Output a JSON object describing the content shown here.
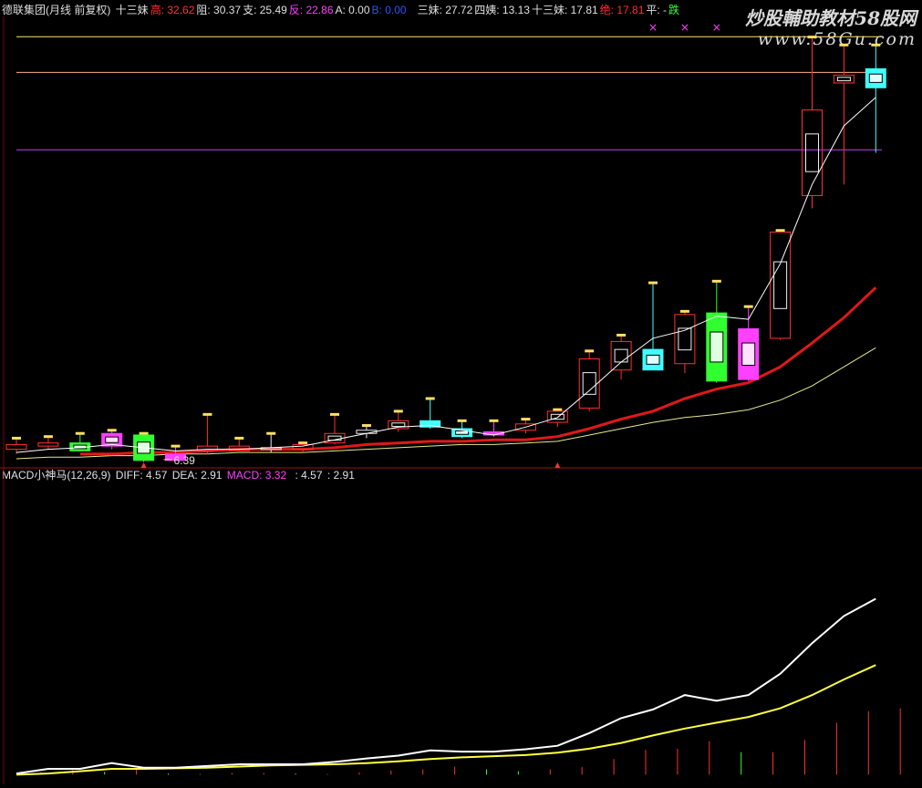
{
  "header": {
    "title": "德联集团(月线 前复权)",
    "items": [
      {
        "label": "十三妹",
        "color": "#e0e0e0"
      },
      {
        "label": "高: 32.62",
        "color": "#ff3030"
      },
      {
        "label": "阻: 30.37",
        "color": "#e0e0e0"
      },
      {
        "label": "支: 25.49",
        "color": "#e0e0e0"
      },
      {
        "label": "反: 22.86",
        "color": "#ff40ff"
      },
      {
        "label": "A: 0.00",
        "color": "#e0e0e0"
      },
      {
        "label": "B: 0.00",
        "color": "#3050ff"
      },
      {
        "label": "三妹: 27.72",
        "color": "#e0e0e0"
      },
      {
        "label": "四姨: 13.13",
        "color": "#e0e0e0"
      },
      {
        "label": "十三妹: 17.81",
        "color": "#e0e0e0"
      },
      {
        "label": "绝: 17.81",
        "color": "#ff3030"
      },
      {
        "label": "平: -",
        "color": "#e0e0e0"
      },
      {
        "label": "跌",
        "color": "#30ff30"
      }
    ]
  },
  "watermark": {
    "line1": "炒股輔助教材58股网",
    "line2": "www.58Gu.com"
  },
  "macd_header": {
    "name": "MACD小神马(12,26,9)",
    "diff": "DIFF: 4.57",
    "dea": "DEA: 2.91",
    "macd": "MACD: 3.32",
    "extra1": ": 4.57",
    "extra2": ": 2.91"
  },
  "colors": {
    "up": "#ff3030",
    "down_green": "#30ff30",
    "magenta": "#ff40ff",
    "cyan": "#40ffff",
    "ma_red": "#e01818",
    "ma_yellow": "#e8e890",
    "line_white": "#ffffff",
    "level_yellow": "#ffe080",
    "level_peach": "#ffb080",
    "level_magenta": "#c040ff",
    "cross_marker": "#ff40ff",
    "divider": "#a01010",
    "arrow": "#ff3030",
    "macd_diff": "#ffffff",
    "macd_dea": "#ffff40",
    "bar_yellow": "#ffe060"
  },
  "chart_data": [
    {
      "type": "candlestick",
      "title": "德联集团(月线 前复权)",
      "ylim": [
        5.6,
        33.9
      ],
      "levels": [
        {
          "name": "高",
          "value": 32.62
        },
        {
          "name": "阻",
          "value": 30.37
        },
        {
          "name": "支",
          "value": 25.49
        },
        {
          "name": "反",
          "value": 22.86
        }
      ],
      "candles": [
        {
          "o": 6.9,
          "h": 7.3,
          "l": 6.3,
          "c": 6.6,
          "color": "up"
        },
        {
          "o": 6.8,
          "h": 7.4,
          "l": 6.6,
          "c": 7.0,
          "color": "up"
        },
        {
          "o": 7.0,
          "h": 7.6,
          "l": 6.6,
          "c": 6.5,
          "color": "green"
        },
        {
          "o": 6.8,
          "h": 7.8,
          "l": 6.6,
          "c": 7.6,
          "color": "magenta"
        },
        {
          "o": 7.5,
          "h": 7.6,
          "l": 5.8,
          "c": 5.9,
          "color": "green"
        },
        {
          "o": 6.3,
          "h": 6.8,
          "l": 6.0,
          "c": 5.9,
          "color": "magenta"
        },
        {
          "o": 6.5,
          "h": 8.8,
          "l": 6.3,
          "c": 6.8,
          "color": "up"
        },
        {
          "o": 6.8,
          "h": 7.3,
          "l": 6.6,
          "c": 6.5,
          "color": "up"
        },
        {
          "o": 6.6,
          "h": 7.6,
          "l": 6.4,
          "c": 6.7,
          "color": "white"
        },
        {
          "o": 6.6,
          "h": 7.0,
          "l": 6.4,
          "c": 6.9,
          "color": "up"
        },
        {
          "o": 7.0,
          "h": 8.8,
          "l": 6.9,
          "c": 7.6,
          "color": "up"
        },
        {
          "o": 7.6,
          "h": 8.1,
          "l": 7.3,
          "c": 7.8,
          "color": "white"
        },
        {
          "o": 7.9,
          "h": 9.0,
          "l": 7.7,
          "c": 8.4,
          "color": "up"
        },
        {
          "o": 8.4,
          "h": 9.8,
          "l": 7.9,
          "c": 8.0,
          "color": "cyan"
        },
        {
          "o": 7.9,
          "h": 8.4,
          "l": 7.3,
          "c": 7.4,
          "color": "cyan"
        },
        {
          "o": 7.7,
          "h": 8.4,
          "l": 7.4,
          "c": 7.5,
          "color": "magenta"
        },
        {
          "o": 7.8,
          "h": 8.5,
          "l": 7.6,
          "c": 8.2,
          "color": "up"
        },
        {
          "o": 8.3,
          "h": 9.1,
          "l": 8.0,
          "c": 9.0,
          "color": "up"
        },
        {
          "o": 9.2,
          "h": 12.8,
          "l": 9.0,
          "c": 12.3,
          "color": "up"
        },
        {
          "o": 11.6,
          "h": 13.8,
          "l": 11.0,
          "c": 13.4,
          "color": "up"
        },
        {
          "o": 12.9,
          "h": 17.1,
          "l": 11.6,
          "c": 11.6,
          "color": "cyan"
        },
        {
          "o": 12.0,
          "h": 15.3,
          "l": 11.4,
          "c": 15.1,
          "color": "up"
        },
        {
          "o": 15.2,
          "h": 17.2,
          "l": 10.8,
          "c": 10.9,
          "color": "green"
        },
        {
          "o": 14.2,
          "h": 15.6,
          "l": 10.9,
          "c": 11.0,
          "color": "magenta"
        },
        {
          "o": 13.6,
          "h": 20.4,
          "l": 13.5,
          "c": 20.3,
          "color": "up"
        },
        {
          "o": 22.6,
          "h": 32.6,
          "l": 21.8,
          "c": 28.0,
          "color": "up"
        },
        {
          "o": 29.7,
          "h": 32.1,
          "l": 23.3,
          "c": 30.2,
          "color": "up"
        },
        {
          "o": 29.4,
          "h": 32.1,
          "l": 25.3,
          "c": 30.6,
          "color": "cyan"
        }
      ],
      "line_white": [
        6.4,
        6.6,
        6.7,
        6.9,
        6.7,
        6.5,
        6.6,
        6.6,
        6.7,
        6.8,
        7.2,
        7.6,
        8.0,
        8.1,
        7.8,
        7.5,
        8.0,
        8.6,
        10.3,
        12.1,
        13.6,
        14.1,
        15.0,
        14.8,
        18.3,
        23.3,
        27.0,
        28.8
      ],
      "ma_red": [
        null,
        null,
        6.3,
        6.3,
        6.4,
        6.4,
        6.5,
        6.6,
        6.6,
        6.6,
        6.7,
        6.9,
        7.0,
        7.1,
        7.1,
        7.2,
        7.2,
        7.4,
        7.9,
        8.5,
        9.0,
        9.8,
        10.4,
        10.8,
        11.8,
        13.3,
        14.9,
        16.8
      ],
      "ma_yellow": [
        6.0,
        6.1,
        6.1,
        6.2,
        6.2,
        6.3,
        6.3,
        6.4,
        6.4,
        6.4,
        6.5,
        6.6,
        6.7,
        6.8,
        6.9,
        6.9,
        7.0,
        7.1,
        7.5,
        7.9,
        8.3,
        8.6,
        8.8,
        9.1,
        9.7,
        10.6,
        11.8,
        13.0
      ],
      "cross_markers": [
        20,
        21,
        22
      ],
      "min_label": {
        "index": 5,
        "text": "6.39"
      },
      "markers": [
        4,
        17
      ]
    },
    {
      "type": "line",
      "title": "MACD小神马(12,26,9)",
      "ylim": [
        -0.2,
        5.05
      ],
      "series": [
        {
          "name": "DIFF",
          "values": [
            0.02,
            0.1,
            0.1,
            0.2,
            0.12,
            0.12,
            0.15,
            0.18,
            0.18,
            0.18,
            0.22,
            0.28,
            0.33,
            0.42,
            0.4,
            0.4,
            0.44,
            0.5,
            0.72,
            0.98,
            1.13,
            1.38,
            1.28,
            1.38,
            1.75,
            2.28,
            2.75,
            3.05
          ]
        },
        {
          "name": "DEA",
          "values": [
            0.0,
            0.02,
            0.06,
            0.1,
            0.1,
            0.11,
            0.12,
            0.14,
            0.16,
            0.17,
            0.18,
            0.2,
            0.23,
            0.27,
            0.3,
            0.32,
            0.34,
            0.38,
            0.45,
            0.55,
            0.68,
            0.8,
            0.9,
            1.0,
            1.15,
            1.38,
            1.65,
            1.9
          ]
        },
        {
          "name": "MACD",
          "values": [
            0.04,
            0.08,
            0.05,
            0.1,
            0.02,
            0.01,
            0.03,
            0.03,
            0.02,
            0.01,
            0.04,
            0.07,
            0.09,
            0.14,
            0.09,
            0.06,
            0.09,
            0.13,
            0.27,
            0.43,
            0.45,
            0.58,
            0.39,
            0.39,
            0.6,
            0.9,
            1.1,
            1.15
          ]
        }
      ]
    }
  ]
}
